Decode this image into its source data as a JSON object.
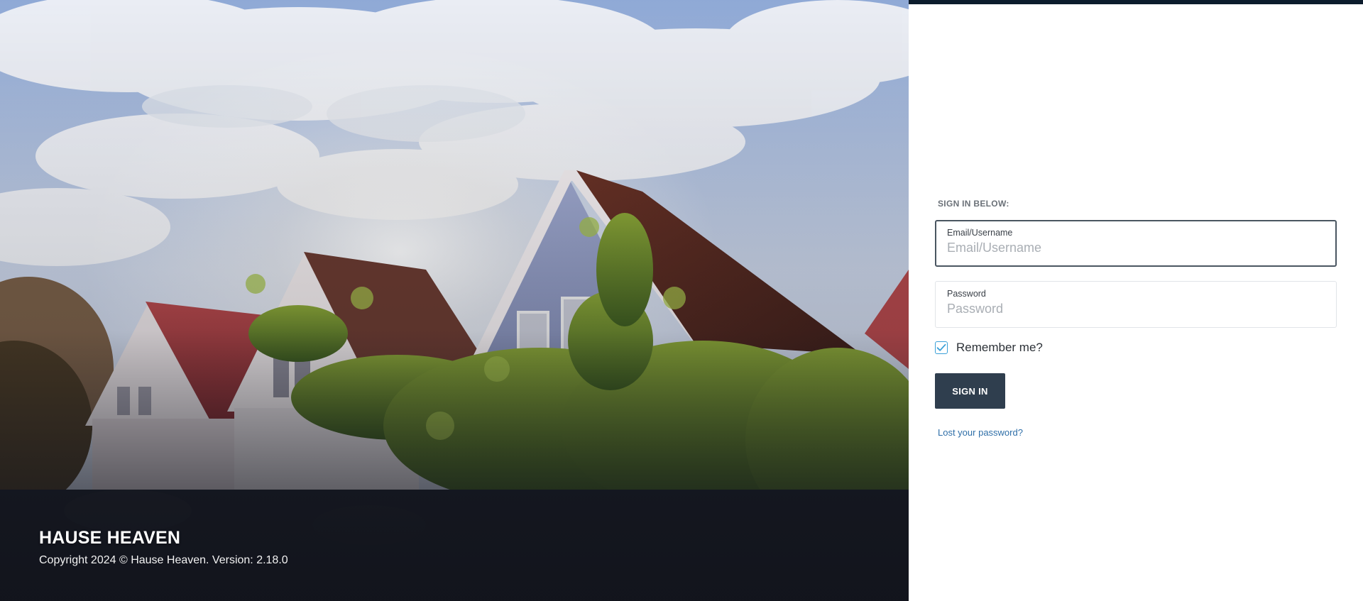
{
  "hero": {
    "image": "suburban-houses-under-cloudy-sky",
    "title": "HAUSE HEAVEN",
    "copyright": "Copyright 2024 © Hause Heaven. Version: 2.18.0"
  },
  "login": {
    "heading": "SIGN IN BELOW:",
    "email": {
      "label": "Email/Username",
      "placeholder": "Email/Username",
      "value": ""
    },
    "password": {
      "label": "Password",
      "placeholder": "Password",
      "value": ""
    },
    "remember": {
      "label": "Remember me?",
      "checked": true
    },
    "submit_label": "SIGN IN",
    "lost_password_label": "Lost your password?"
  },
  "colors": {
    "topbar": "#0c1c2c",
    "button": "#2f3e4e",
    "link": "#2f6fa8",
    "checkbox": "#3aa0d8"
  },
  "icons": {
    "checkbox": "check-icon"
  }
}
